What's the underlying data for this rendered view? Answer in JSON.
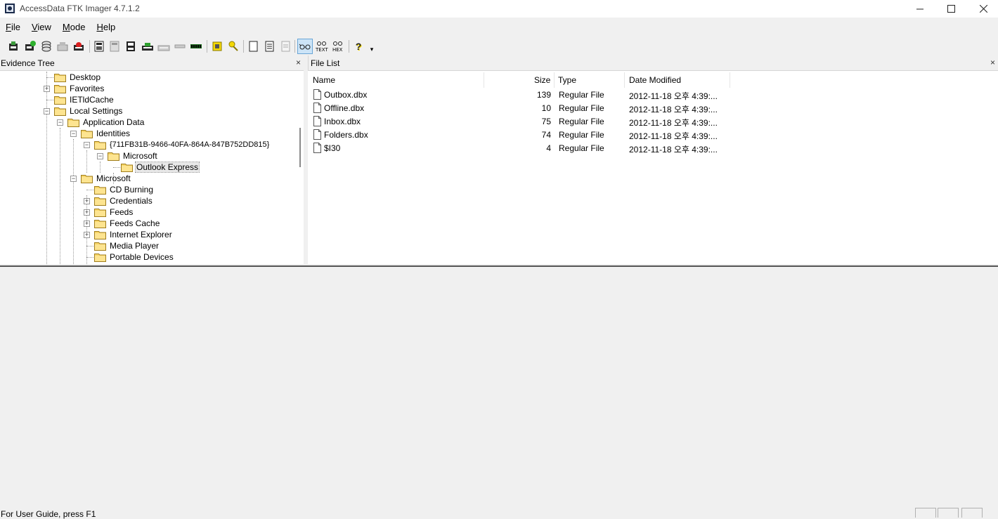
{
  "window": {
    "title": "AccessData FTK Imager 4.7.1.2",
    "controls": {
      "minimize": "—",
      "maximize": "☐",
      "close": "✕"
    }
  },
  "menu": [
    {
      "label": "File",
      "accel": "F",
      "rest": "ile"
    },
    {
      "label": "View",
      "accel": "V",
      "rest": "iew"
    },
    {
      "label": "Mode",
      "accel": "M",
      "rest": "ode"
    },
    {
      "label": "Help",
      "accel": "H",
      "rest": "elp"
    }
  ],
  "evidence_tree": {
    "title": "Evidence Tree",
    "close": "×",
    "nodes": [
      {
        "label": "Desktop",
        "expander": ""
      },
      {
        "label": "Favorites",
        "expander": "+"
      },
      {
        "label": "IETldCache",
        "expander": ""
      },
      {
        "label": "Local Settings",
        "expander": "−"
      },
      {
        "label": "Application Data",
        "expander": "−"
      },
      {
        "label": "Identities",
        "expander": "−"
      },
      {
        "label": "{711FB31B-9466-40FA-864A-847B752DD815}",
        "expander": "−"
      },
      {
        "label": "Microsoft",
        "expander": "−"
      },
      {
        "label": "Outlook Express",
        "expander": "",
        "selected": true
      },
      {
        "label": "Microsoft",
        "expander": "−"
      },
      {
        "label": "CD Burning",
        "expander": ""
      },
      {
        "label": "Credentials",
        "expander": "+"
      },
      {
        "label": "Feeds",
        "expander": "+"
      },
      {
        "label": "Feeds Cache",
        "expander": "+"
      },
      {
        "label": "Internet Explorer",
        "expander": "+"
      },
      {
        "label": "Media Player",
        "expander": ""
      },
      {
        "label": "Portable Devices",
        "expander": ""
      }
    ]
  },
  "file_list": {
    "title": "File List",
    "close": "×",
    "columns": {
      "name": "Name",
      "size": "Size",
      "type": "Type",
      "date": "Date Modified"
    },
    "rows": [
      {
        "name": "Outbox.dbx",
        "size": "139",
        "type": "Regular File",
        "date": "2012-11-18 오후 4:39:..."
      },
      {
        "name": "Offline.dbx",
        "size": "10",
        "type": "Regular File",
        "date": "2012-11-18 오후 4:39:..."
      },
      {
        "name": "Inbox.dbx",
        "size": "75",
        "type": "Regular File",
        "date": "2012-11-18 오후 4:39:..."
      },
      {
        "name": "Folders.dbx",
        "size": "74",
        "type": "Regular File",
        "date": "2012-11-18 오후 4:39:..."
      },
      {
        "name": "$I30",
        "size": "4",
        "type": "Regular File",
        "date": "2012-11-18 오후 4:39:..."
      }
    ]
  },
  "toolbar": {
    "items": [
      "add-evidence-icon",
      "add-all-devices-icon",
      "image-mounting-icon",
      "remove-evidence-icon",
      "remove-all-evidence-icon",
      "create-disk-image-icon",
      "export-disk-image-icon",
      "export-logical-image-icon",
      "add-to-custom-image-icon",
      "create-custom-image-icon",
      "decrypt-icon",
      "verify-drive-icon",
      "capture-memory-icon",
      "obtain-protected-files-icon",
      "detect-efs-icon",
      "export-files-icon",
      "export-hash-list-icon",
      "auto-view-icon",
      "text-view-icon",
      "hex-view-icon",
      "help-icon"
    ],
    "text_label": "TEXT",
    "hex_label": "HEX",
    "help_glyph": "?",
    "overflow_glyph": "▾"
  },
  "status": {
    "text": "For User Guide, press F1"
  }
}
